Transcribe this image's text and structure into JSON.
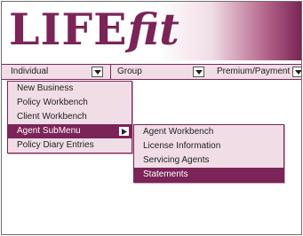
{
  "logo": {
    "life": "LIFE",
    "fit": "fit"
  },
  "menubar": {
    "items": [
      {
        "label": "Individual"
      },
      {
        "label": "Group"
      },
      {
        "label": "Premium/Payment"
      }
    ]
  },
  "dropdown": {
    "items": [
      {
        "label": "New Business"
      },
      {
        "label": "Policy Workbench"
      },
      {
        "label": "Client Workbench"
      },
      {
        "label": "Agent SubMenu"
      },
      {
        "label": "Policy Diary Entries"
      }
    ],
    "selected": "Agent SubMenu"
  },
  "submenu": {
    "items": [
      {
        "label": "Agent Workbench"
      },
      {
        "label": "License Information"
      },
      {
        "label": "Servicing Agents"
      },
      {
        "label": "Statements"
      }
    ],
    "selected": "Statements"
  },
  "colors": {
    "brand": "#7b2458",
    "menu_bg": "#f1dde6",
    "highlight": "#7b2458"
  },
  "icons": {
    "dropdown": "chevron-down-icon",
    "submenu": "arrow-right-icon"
  }
}
